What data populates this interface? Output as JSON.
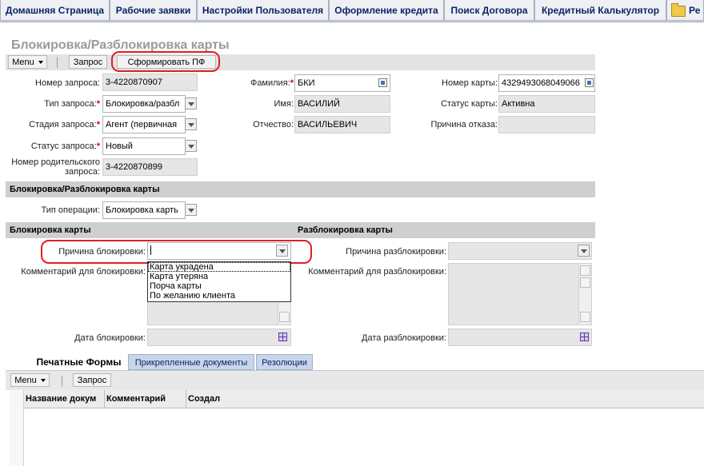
{
  "topnav": {
    "tabs": [
      {
        "label": "Домашняя Страница"
      },
      {
        "label": "Рабочие заявки"
      },
      {
        "label": "Настройки Пользователя"
      },
      {
        "label": "Оформление кредита"
      },
      {
        "label": "Поиск Договора"
      },
      {
        "label": "Кредитный Калькулятор"
      },
      {
        "label": "Ре"
      }
    ],
    "folder_icon": "folder-icon"
  },
  "page": {
    "title": "Блокировка/Разблокировка карты"
  },
  "toolbar": {
    "menu_label": "Menu",
    "request_label": "Запрос",
    "generate_pf_label": "Сформировать ПФ"
  },
  "form": {
    "request_number": {
      "label": "Номер запроса:",
      "value": "3-4220870907"
    },
    "request_type": {
      "label": "Тип запроса:",
      "value": "Блокировка/разбл"
    },
    "request_stage": {
      "label": "Стадия запроса:",
      "value": "Агент (первичная"
    },
    "request_status": {
      "label": "Статус запроса:",
      "value": "Новый"
    },
    "parent_request_number": {
      "label_line1": "Номер родительского",
      "label_line2": "запроса:",
      "value": "3-4220870899"
    },
    "last_name": {
      "label": "Фамилия:",
      "value": "БКИ"
    },
    "first_name": {
      "label": "Имя:",
      "value": "ВАСИЛИЙ"
    },
    "patronymic": {
      "label": "Отчество:",
      "value": "ВАСИЛЬЕВИЧ"
    },
    "card_number": {
      "label": "Номер карты:",
      "value": "4329493068049066"
    },
    "card_status": {
      "label": "Статус карты:",
      "value": "Активна"
    },
    "reject_reason": {
      "label": "Причина отказа:",
      "value": ""
    }
  },
  "section_main": {
    "title": "Блокировка/Разблокировка карты",
    "operation_type": {
      "label": "Тип операции:",
      "value": "Блокировка карть"
    }
  },
  "block": {
    "title": "Блокировка карты",
    "reason": {
      "label": "Причина блокировки:",
      "value": ""
    },
    "reason_options": [
      "Карта украдена",
      "Карта утеряна",
      "Порча карты",
      "По желанию клиента"
    ],
    "comment": {
      "label": "Комментарий для блокировки:"
    },
    "date": {
      "label": "Дата блокировки:",
      "value": ""
    }
  },
  "unblock": {
    "title": "Разблокировка карты",
    "reason": {
      "label": "Причина разблокировки:",
      "value": ""
    },
    "comment": {
      "label": "Комментарий для разблокировки:"
    },
    "date": {
      "label": "Дата разблокировки:",
      "value": ""
    }
  },
  "bottom_tabs": [
    {
      "label": "Печатные Формы",
      "active": true
    },
    {
      "label": "Прикрепленные документы",
      "active": false
    },
    {
      "label": "Резолюции",
      "active": false
    }
  ],
  "lower_toolbar": {
    "menu_label": "Menu",
    "request_label": "Запрос"
  },
  "grid": {
    "columns": [
      "Название докум",
      "Комментарий",
      "Создал"
    ]
  },
  "colors": {
    "highlight_ring": "#e02020",
    "required_star": "#d40000",
    "nav_text": "#0a246a",
    "active_tab_bg": "#ffffff",
    "inactive_tab_bg": "#c9d6ea"
  }
}
